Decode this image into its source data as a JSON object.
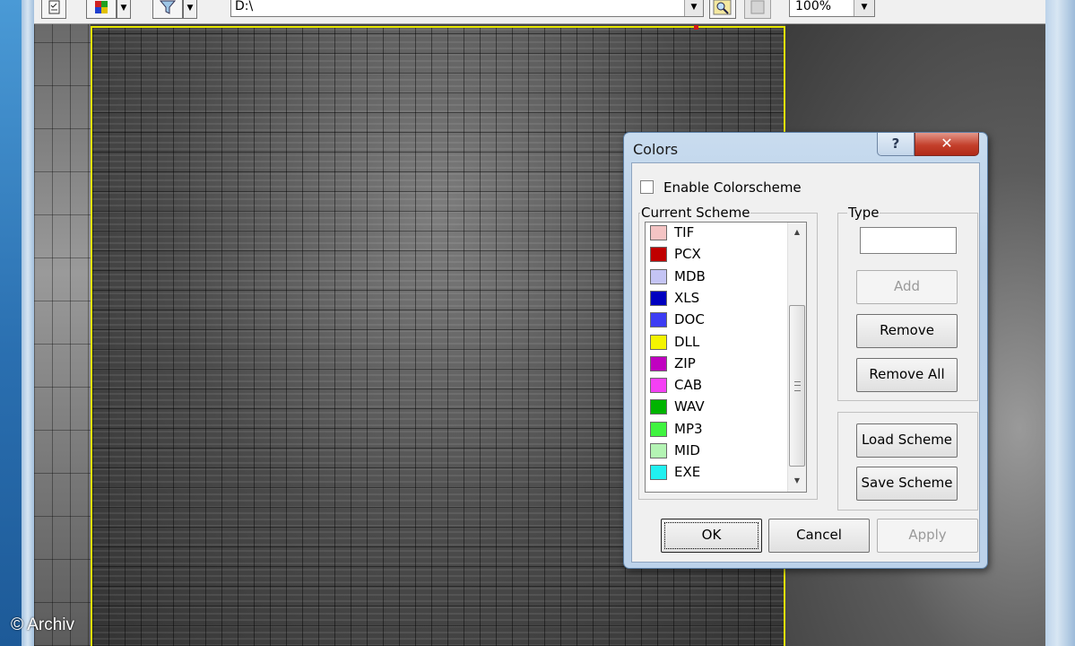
{
  "toolbar": {
    "path_value": "D:\\",
    "zoom_value": "100%"
  },
  "watermark": "© Archiv",
  "dialog": {
    "title": "Colors",
    "help_label": "?",
    "close_label": "✕",
    "enable_colorscheme_label": "Enable Colorscheme",
    "enable_colorscheme_checked": false,
    "current_scheme_label": "Current Scheme",
    "type_label": "Type",
    "type_value": "",
    "scheme_items": [
      {
        "label": "TIF",
        "color": "#f4c4c4"
      },
      {
        "label": "PCX",
        "color": "#c00000"
      },
      {
        "label": "MDB",
        "color": "#c4c4f4"
      },
      {
        "label": "XLS",
        "color": "#0000c0"
      },
      {
        "label": "DOC",
        "color": "#3c3cf4"
      },
      {
        "label": "DLL",
        "color": "#f4f400"
      },
      {
        "label": "ZIP",
        "color": "#c000c0"
      },
      {
        "label": "CAB",
        "color": "#f440f4"
      },
      {
        "label": "WAV",
        "color": "#00b400"
      },
      {
        "label": "MP3",
        "color": "#40f440"
      },
      {
        "label": "MID",
        "color": "#b4f4b4"
      },
      {
        "label": "EXE",
        "color": "#20f0f0"
      }
    ],
    "buttons": {
      "add": "Add",
      "remove": "Remove",
      "remove_all": "Remove All",
      "load_scheme": "Load Scheme",
      "save_scheme": "Save Scheme",
      "ok": "OK",
      "cancel": "Cancel",
      "apply": "Apply"
    }
  }
}
